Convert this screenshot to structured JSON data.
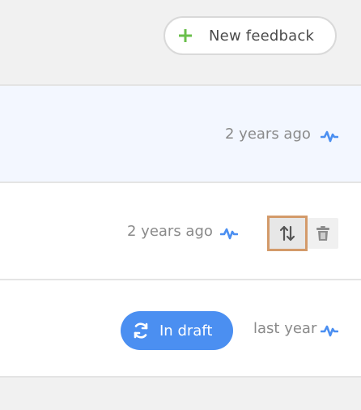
{
  "toolbar": {
    "new_feedback_label": "New feedback",
    "plus_icon": "plus-icon",
    "plus_color": "#6abf4b"
  },
  "rows": [
    {
      "time": "2 years ago",
      "activity_icon": "pulse-icon",
      "highlighted": true
    },
    {
      "time": "2 years ago",
      "activity_icon": "pulse-icon",
      "actions": [
        {
          "icon": "sort-arrows-icon"
        },
        {
          "icon": "trash-icon"
        }
      ]
    },
    {
      "status": "In draft",
      "status_icon": "refresh-icon",
      "time": "last year",
      "activity_icon": "pulse-icon"
    }
  ],
  "colors": {
    "accent_blue": "#4b8ff1",
    "highlight_row": "#f3f7ff",
    "focus_outline": "#d39a6a",
    "text_muted": "#8a8a8a"
  }
}
